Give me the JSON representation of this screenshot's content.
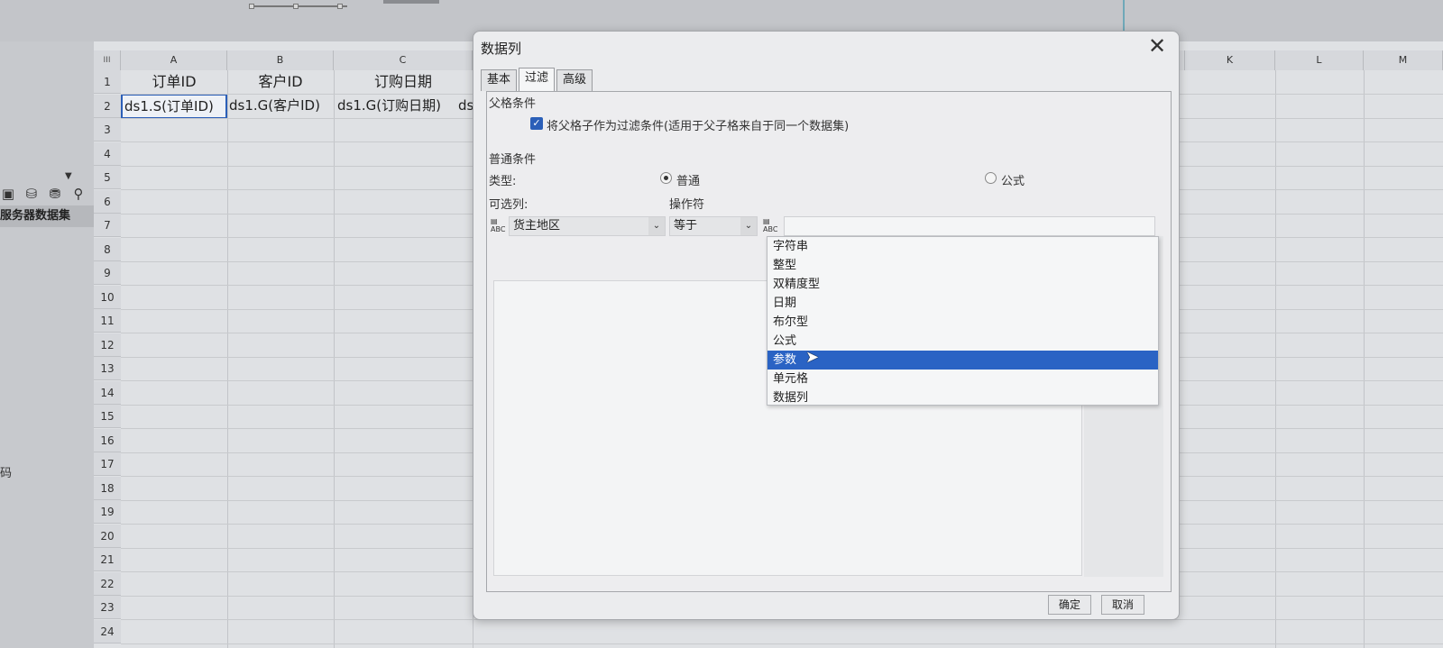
{
  "sheet": {
    "columns": [
      "A",
      "B",
      "C",
      "K",
      "L",
      "M"
    ],
    "corner_label": "III",
    "rows": [
      "1",
      "2",
      "3",
      "4",
      "5",
      "6",
      "7",
      "8",
      "9",
      "10",
      "11",
      "12",
      "13",
      "14",
      "15",
      "16",
      "17",
      "18",
      "19",
      "20",
      "21",
      "22",
      "23",
      "24"
    ],
    "row1": [
      "订单ID",
      "客户ID",
      "订购日期"
    ],
    "row2": [
      "ds1.S(订单ID)",
      "ds1.G(客户ID)",
      "ds1.G(订购日期)",
      "ds"
    ]
  },
  "left_panel": {
    "dataset_label": "服务器数据集",
    "code_label": "码"
  },
  "dialog": {
    "title": "数据列",
    "close_glyph": "✕",
    "tabs": [
      "基本",
      "过滤",
      "高级"
    ],
    "active_tab": "过滤",
    "parent_section": "父格条件",
    "parent_checkbox_label": "将父格子作为过滤条件(适用于父子格来自于同一个数据集)",
    "parent_checkbox_checked": true,
    "normal_section": "普通条件",
    "type_label": "类型:",
    "radio_normal": "普通",
    "radio_formula": "公式",
    "selected_type": "普通",
    "column_label": "可选列:",
    "operator_label": "操作符",
    "column_value": "货主地区",
    "operator_value": "等于",
    "value_types": [
      "字符串",
      "整型",
      "双精度型",
      "日期",
      "布尔型",
      "公式",
      "参数",
      "单元格",
      "数据列"
    ],
    "highlighted_type": "参数",
    "ok_button": "确定",
    "cancel_button": "取消"
  },
  "icons": {
    "left_toolbar": [
      "data-icon",
      "database-icon",
      "database-alt-icon",
      "search-icon"
    ],
    "abc_icon": "ABC"
  },
  "colors": {
    "highlight": "#2a63c4",
    "selection_border": "#2b5fb8"
  }
}
